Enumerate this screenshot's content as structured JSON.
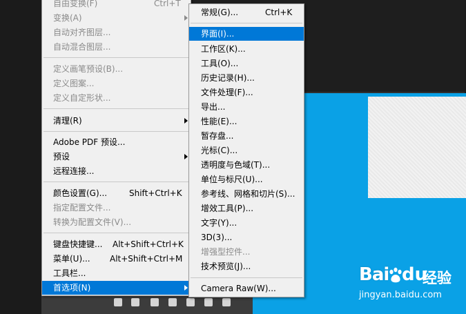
{
  "main_menu": {
    "items": [
      {
        "label": "自由变换(F)",
        "shortcut": "Ctrl+T",
        "disabled": true
      },
      {
        "label": "变换(A)",
        "disabled": true,
        "submenu": true
      },
      {
        "label": "自动对齐图层...",
        "disabled": true
      },
      {
        "label": "自动混合图层...",
        "disabled": true
      },
      {
        "label": "定义画笔预设(B)...",
        "disabled": true
      },
      {
        "label": "定义图案...",
        "disabled": true
      },
      {
        "label": "定义自定形状...",
        "disabled": true
      },
      {
        "label": "清理(R)",
        "submenu": true
      },
      {
        "label": "Adobe PDF 预设..."
      },
      {
        "label": "预设",
        "submenu": true
      },
      {
        "label": "远程连接..."
      },
      {
        "label": "颜色设置(G)...",
        "shortcut": "Shift+Ctrl+K"
      },
      {
        "label": "指定配置文件...",
        "disabled": true
      },
      {
        "label": "转换为配置文件(V)...",
        "disabled": true
      },
      {
        "label": "键盘快捷键...",
        "shortcut": "Alt+Shift+Ctrl+K"
      },
      {
        "label": "菜单(U)...",
        "shortcut": "Alt+Shift+Ctrl+M"
      },
      {
        "label": "工具栏..."
      },
      {
        "label": "首选项(N)",
        "submenu": true,
        "highlight": true
      }
    ]
  },
  "sub_menu": {
    "items": [
      {
        "label": "常规(G)...",
        "shortcut": "Ctrl+K"
      },
      {
        "label": "界面(I)...",
        "highlight": true
      },
      {
        "label": "工作区(K)..."
      },
      {
        "label": "工具(O)..."
      },
      {
        "label": "历史记录(H)..."
      },
      {
        "label": "文件处理(F)..."
      },
      {
        "label": "导出..."
      },
      {
        "label": "性能(E)..."
      },
      {
        "label": "暂存盘..."
      },
      {
        "label": "光标(C)..."
      },
      {
        "label": "透明度与色域(T)..."
      },
      {
        "label": "单位与标尺(U)..."
      },
      {
        "label": "参考线、网格和切片(S)..."
      },
      {
        "label": "增效工具(P)..."
      },
      {
        "label": "文字(Y)..."
      },
      {
        "label": "3D(3)..."
      },
      {
        "label": "增强型控件...",
        "disabled": true
      },
      {
        "label": "技术预览(J)..."
      },
      {
        "label": "Camera Raw(W)..."
      }
    ]
  },
  "watermark": {
    "brand_left": "Bai",
    "brand_right": "du",
    "jingyan": "经验",
    "url": "jingyan.baidu.com"
  },
  "colors": {
    "desktop_blue": "#0aa1e6",
    "highlight": "#0078d7",
    "menu_bg": "#f0f0f0"
  }
}
